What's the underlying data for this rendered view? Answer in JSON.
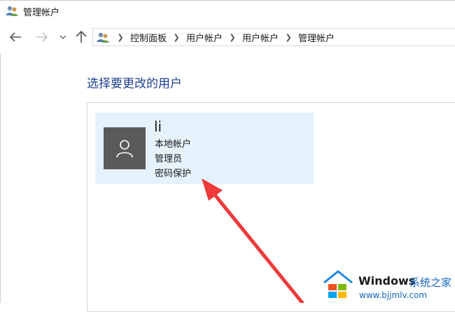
{
  "window": {
    "title": "管理帐户",
    "icon": "users-control-panel-icon"
  },
  "nav": {
    "back": "back-arrow-icon",
    "forward": "forward-arrow-icon",
    "recent": "chevron-down-icon",
    "up": "up-arrow-icon"
  },
  "address": {
    "icon": "users-control-panel-icon",
    "breadcrumbs": [
      "控制面板",
      "用户帐户",
      "用户帐户",
      "管理帐户"
    ]
  },
  "page": {
    "heading": "选择要更改的用户"
  },
  "accounts": [
    {
      "name": "li",
      "type": "本地帐户",
      "role": "管理员",
      "protection": "密码保护",
      "avatar_icon": "user-silhouette-icon"
    }
  ],
  "watermark": {
    "brand": "Windows",
    "site_cn": "系统之家",
    "url": "www.bjjmlv.com"
  },
  "colors": {
    "heading": "#1e3f8f",
    "tile_bg": "#e5f1fb",
    "avatar_bg": "#5a5a5a",
    "arrow": "#ee3a3a",
    "watermark_link": "#1565c0"
  }
}
